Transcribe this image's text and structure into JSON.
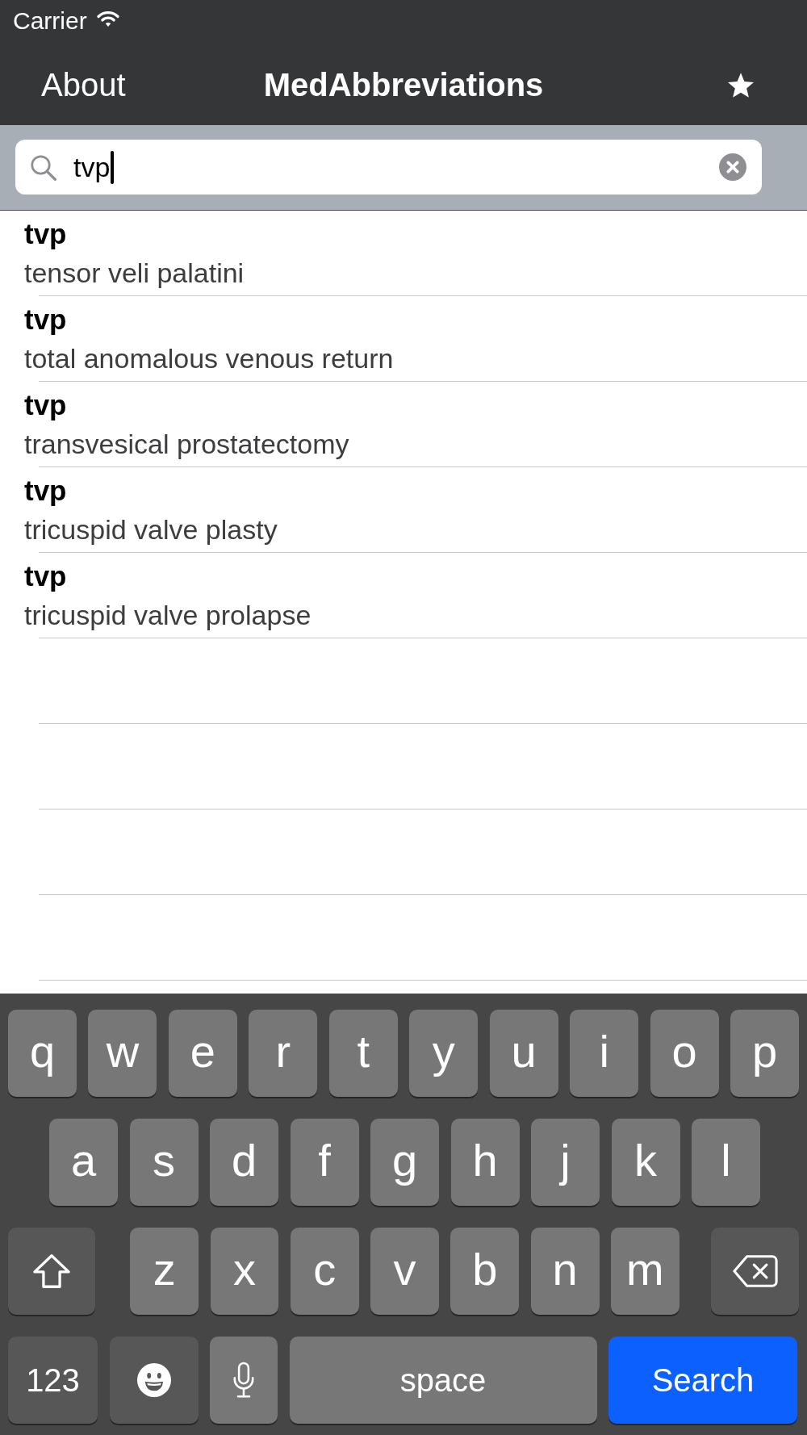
{
  "status_bar": {
    "carrier": "Carrier"
  },
  "nav_bar": {
    "left_button": "About",
    "title": "MedAbbreviations"
  },
  "search_bar": {
    "value": "tvp"
  },
  "results": [
    {
      "abbreviation": "tvp",
      "meaning": "tensor veli palatini"
    },
    {
      "abbreviation": "tvp",
      "meaning": "total anomalous venous return"
    },
    {
      "abbreviation": "tvp",
      "meaning": "transvesical prostatectomy"
    },
    {
      "abbreviation": "tvp",
      "meaning": "tricuspid valve plasty"
    },
    {
      "abbreviation": "tvp",
      "meaning": "tricuspid valve prolapse"
    }
  ],
  "keyboard": {
    "letter_rows": [
      {
        "keys": [
          {
            "kind": "letter",
            "label": "q"
          },
          {
            "kind": "letter",
            "label": "w"
          },
          {
            "kind": "letter",
            "label": "e"
          },
          {
            "kind": "letter",
            "label": "r"
          },
          {
            "kind": "letter",
            "label": "t"
          },
          {
            "kind": "letter",
            "label": "y"
          },
          {
            "kind": "letter",
            "label": "u"
          },
          {
            "kind": "letter",
            "label": "i"
          },
          {
            "kind": "letter",
            "label": "o"
          },
          {
            "kind": "letter",
            "label": "p"
          }
        ]
      },
      {
        "keys": [
          {
            "kind": "letter",
            "label": "a"
          },
          {
            "kind": "letter",
            "label": "s"
          },
          {
            "kind": "letter",
            "label": "d"
          },
          {
            "kind": "letter",
            "label": "f"
          },
          {
            "kind": "letter",
            "label": "g"
          },
          {
            "kind": "letter",
            "label": "h"
          },
          {
            "kind": "letter",
            "label": "j"
          },
          {
            "kind": "letter",
            "label": "k"
          },
          {
            "kind": "letter",
            "label": "l"
          }
        ]
      },
      {
        "keys": [
          {
            "kind": "shift"
          },
          {
            "kind": "letter",
            "label": "z"
          },
          {
            "kind": "letter",
            "label": "x"
          },
          {
            "kind": "letter",
            "label": "c"
          },
          {
            "kind": "letter",
            "label": "v"
          },
          {
            "kind": "letter",
            "label": "b"
          },
          {
            "kind": "letter",
            "label": "n"
          },
          {
            "kind": "letter",
            "label": "m"
          },
          {
            "kind": "delete"
          }
        ]
      }
    ],
    "bottom_row": {
      "keys": [
        {
          "kind": "numbers",
          "label": "123"
        },
        {
          "kind": "emoji"
        },
        {
          "kind": "dictation"
        },
        {
          "kind": "space",
          "label": "space"
        },
        {
          "kind": "return",
          "label": "Search"
        }
      ]
    }
  }
}
